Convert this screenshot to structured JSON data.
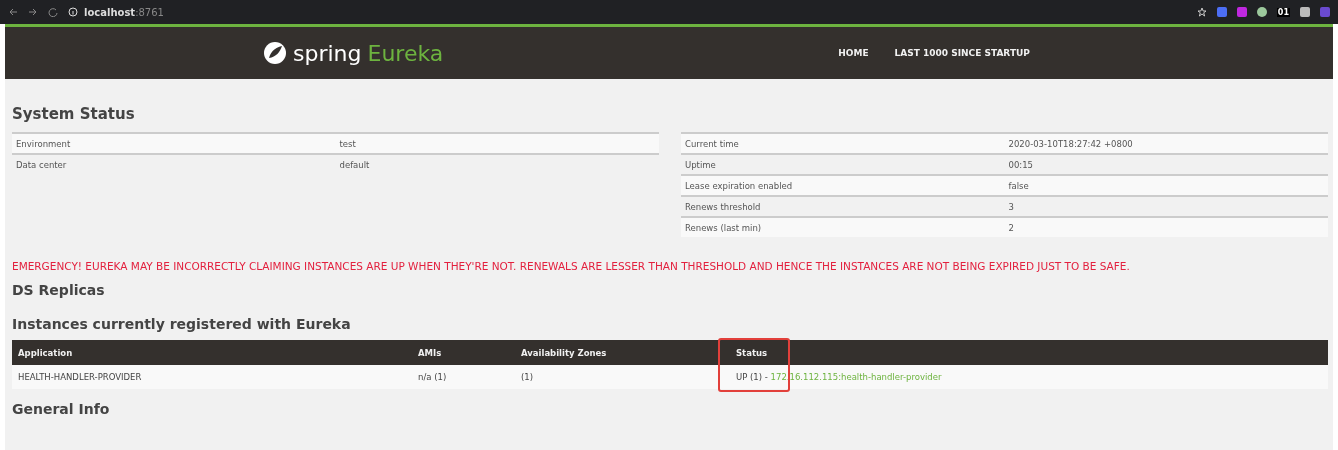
{
  "browser": {
    "host": "localhost",
    "port": ":8761",
    "badge": "01"
  },
  "navbar": {
    "brand_word": "spring",
    "brand_product": "Eureka",
    "links": [
      "HOME",
      "LAST 1000 SINCE STARTUP"
    ]
  },
  "system_status": {
    "title": "System Status",
    "left_rows": [
      {
        "label": "Environment",
        "value": "test"
      },
      {
        "label": "Data center",
        "value": "default"
      }
    ],
    "right_rows": [
      {
        "label": "Current time",
        "value": "2020-03-10T18:27:42 +0800"
      },
      {
        "label": "Uptime",
        "value": "00:15"
      },
      {
        "label": "Lease expiration enabled",
        "value": "false"
      },
      {
        "label": "Renews threshold",
        "value": "3"
      },
      {
        "label": "Renews (last min)",
        "value": "2"
      }
    ]
  },
  "alert": "EMERGENCY! EUREKA MAY BE INCORRECTLY CLAIMING INSTANCES ARE UP WHEN THEY'RE NOT. RENEWALS ARE LESSER THAN THRESHOLD AND HENCE THE INSTANCES ARE NOT BEING EXPIRED JUST TO BE SAFE.",
  "ds_replicas": {
    "title": "DS Replicas"
  },
  "instances": {
    "title": "Instances currently registered with Eureka",
    "columns": [
      "Application",
      "AMIs",
      "Availability Zones",
      "Status"
    ],
    "rows": [
      {
        "application": "HEALTH-HANDLER-PROVIDER",
        "amis": "n/a (1)",
        "zones": "(1)",
        "status": "UP (1) - ",
        "instance_link": "172.16.112.115:health-handler-provider"
      }
    ]
  },
  "general_info": {
    "title": "General Info"
  }
}
